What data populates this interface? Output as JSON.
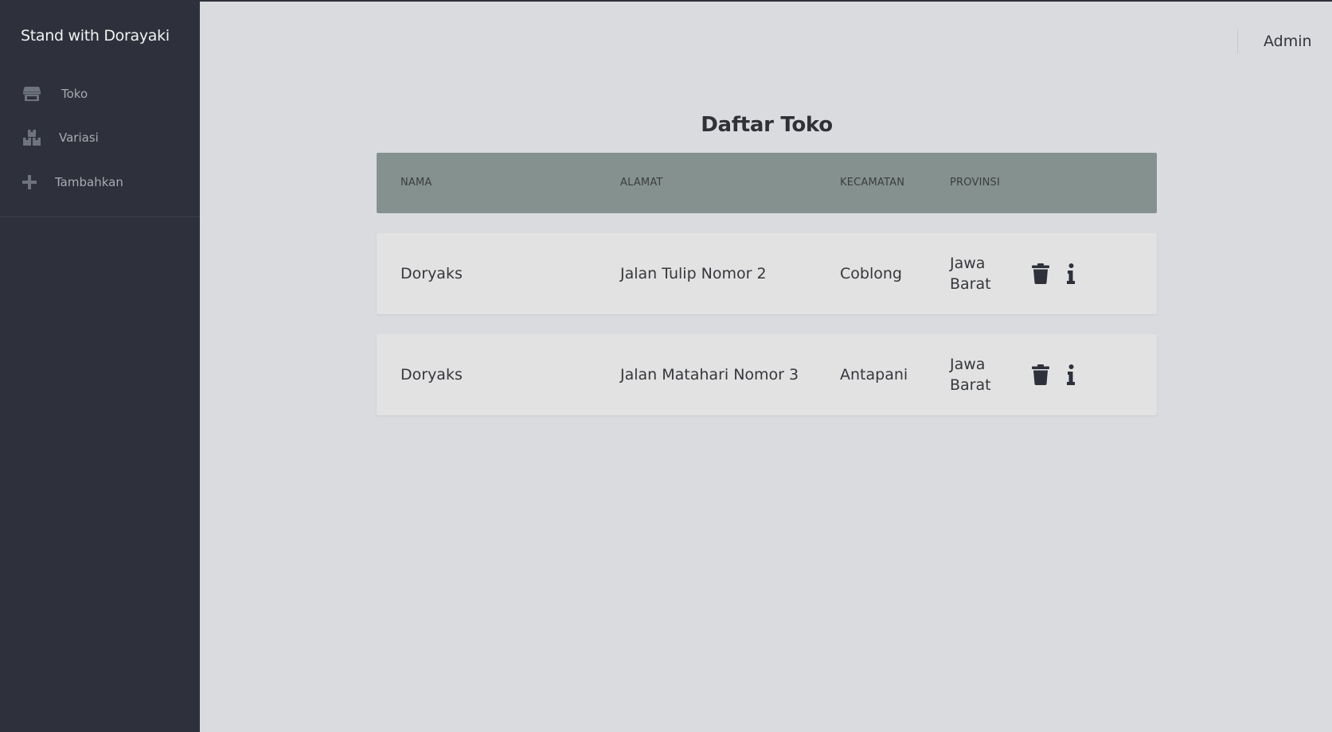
{
  "app": {
    "brand": "Stand with Dorayaki",
    "user": "Admin"
  },
  "sidebar": {
    "items": [
      {
        "label": "Toko",
        "icon": "store-icon"
      },
      {
        "label": "Variasi",
        "icon": "boxes-icon"
      },
      {
        "label": "Tambahkan",
        "icon": "plus-icon"
      }
    ]
  },
  "main": {
    "title": "Daftar Toko",
    "columns": [
      "NAMA",
      "ALAMAT",
      "KECAMATAN",
      "PROVINSI"
    ],
    "rows": [
      {
        "nama": "Doryaks",
        "alamat": "Jalan Tulip Nomor 2",
        "kecamatan": "Coblong",
        "provinsi": "Jawa Barat"
      },
      {
        "nama": "Doryaks",
        "alamat": "Jalan Matahari Nomor 3",
        "kecamatan": "Antapani",
        "provinsi": "Jawa Barat"
      }
    ],
    "row_actions": [
      "trash-icon",
      "info-icon"
    ]
  },
  "colors": {
    "sidebar_bg": "#2e313c",
    "page_bg": "#dadbdf",
    "table_header_bg": "#85918f",
    "row_bg": "#e2e2e2"
  }
}
